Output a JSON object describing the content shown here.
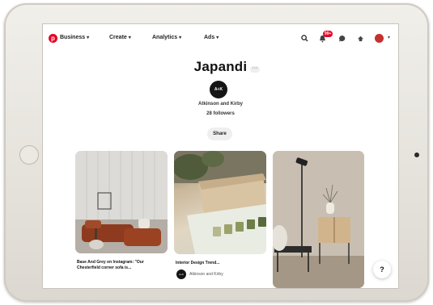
{
  "nav": {
    "items": [
      {
        "label": "Business"
      },
      {
        "label": "Create"
      },
      {
        "label": "Analytics"
      },
      {
        "label": "Ads"
      }
    ],
    "icons": [
      "search-icon",
      "notifications-icon",
      "messages-icon",
      "updates-icon",
      "profile-avatar"
    ],
    "notification_badge": "99+"
  },
  "board": {
    "title": "Japandi",
    "more_label": "···",
    "owner_initials": "A+K",
    "owner_name": "Atkinson and Kirby",
    "followers": "28 followers",
    "share_label": "Share"
  },
  "pins": [
    {
      "caption": "Base And Grey on Instagram: \"Our Chesterfield corner sofa is..."
    },
    {
      "caption": "Interior Design Trend...",
      "creator": "Atkinson and Kirby",
      "creator_initials": "A+K"
    },
    {
      "caption": ""
    }
  ],
  "help_label": "?",
  "colors": {
    "brand": "#e60023",
    "avatar_bg": "#151515"
  }
}
